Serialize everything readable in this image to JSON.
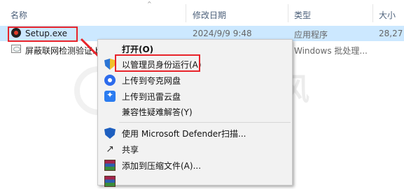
{
  "columns": {
    "name": "名称",
    "modified": "修改日期",
    "type": "类型",
    "size": "大小"
  },
  "files": [
    {
      "name": "Setup.exe",
      "modified": "2024/9/9 9:48",
      "type": "应用程序",
      "size": "28,27"
    },
    {
      "name": "屏蔽联网检测验证.b",
      "modified": "",
      "type": "Windows 批处理...",
      "size": ""
    }
  ],
  "context_menu": {
    "items": [
      {
        "label": "打开(O)",
        "icon": "none",
        "bold": true
      },
      {
        "label": "以管理员身份运行(A)",
        "icon": "uac-shield-icon"
      },
      {
        "label": "上传到夸克网盘",
        "icon": "quark-icon"
      },
      {
        "label": "上传到迅雷云盘",
        "icon": "xunlei-icon"
      },
      {
        "label": "兼容性疑难解答(Y)",
        "icon": "none"
      },
      {
        "label": "使用 Microsoft Defender扫描...",
        "icon": "defender-icon"
      },
      {
        "label": "共享",
        "icon": "share-icon"
      },
      {
        "label": "添加到压缩文件(A)...",
        "icon": "winrar-icon"
      }
    ]
  },
  "watermark": "源子风",
  "colors": {
    "selection": "#cce8ff",
    "highlight_box": "#e8232a",
    "menu_bg": "#f2f2f2"
  }
}
